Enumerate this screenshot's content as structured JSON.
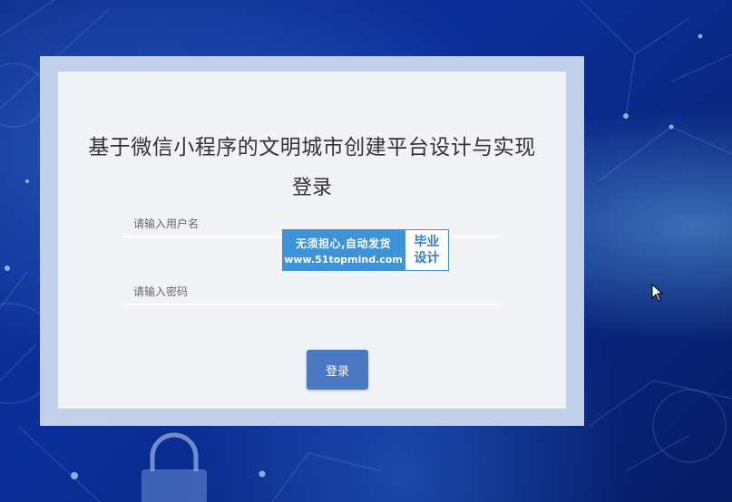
{
  "login": {
    "title": "基于微信小程序的文明城市创建平台设计与实现",
    "subtitle": "登录",
    "username_placeholder": "请输入用户名",
    "password_placeholder": "请输入密码",
    "submit_label": "登录"
  },
  "watermark": {
    "slogan": "无须担心,自动发货",
    "url": "www.51topmind.com",
    "badge_line1": "毕业",
    "badge_line2": "设计"
  },
  "colors": {
    "background": "#0b2f9a",
    "card_border": "#c2cfeb",
    "card": "#f1f3f7",
    "button": "#4a78c2",
    "watermark": "#3e92d6"
  },
  "icons": [
    "lock-icon",
    "mouse-cursor-icon"
  ]
}
